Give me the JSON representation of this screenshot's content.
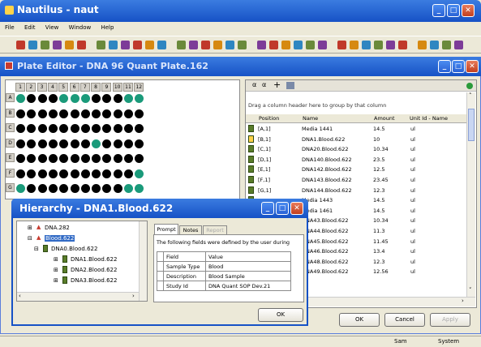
{
  "app": {
    "title": "Nautilus - naut"
  },
  "menu": [
    "File",
    "Edit",
    "View",
    "Window",
    "Help"
  ],
  "plate_editor": {
    "title": "Plate Editor - DNA 96 Quant Plate.162",
    "col_headers": [
      "1",
      "2",
      "3",
      "4",
      "5",
      "6",
      "7",
      "8",
      "9",
      "10",
      "11",
      "12"
    ],
    "row_headers": [
      "A",
      "B",
      "C",
      "D",
      "E",
      "F",
      "G"
    ],
    "well_colors": {
      "filled": "#000000",
      "empty": "#1a9a7a"
    }
  },
  "grid": {
    "group_hint": "Drag a column header here to group by that column",
    "headers": [
      "Position",
      "Name",
      "Amount",
      "Unit Id - Name"
    ],
    "rows": [
      {
        "pos": "[A,1]",
        "name": "Media 1441",
        "amount": "14.5",
        "unit": "ul"
      },
      {
        "pos": "[B,1]",
        "name": "DNA1.Blood.622",
        "amount": "10",
        "unit": "ul"
      },
      {
        "pos": "[C,1]",
        "name": "DNA20.Blood.622",
        "amount": "10.34",
        "unit": "ul"
      },
      {
        "pos": "[D,1]",
        "name": "DNA140.Blood.622",
        "amount": "23.5",
        "unit": "ul"
      },
      {
        "pos": "[E,1]",
        "name": "DNA142.Blood.622",
        "amount": "12.5",
        "unit": "ul"
      },
      {
        "pos": "[F,1]",
        "name": "DNA143.Blood.622",
        "amount": "23.45",
        "unit": "ul"
      },
      {
        "pos": "[G,1]",
        "name": "DNA144.Blood.622",
        "amount": "12.3",
        "unit": "ul"
      },
      {
        "pos": "",
        "name": "Media 1443",
        "amount": "14.5",
        "unit": "ul"
      },
      {
        "pos": "",
        "name": "Media 1461",
        "amount": "14.5",
        "unit": "ul"
      },
      {
        "pos": "",
        "name": "DNA43.Blood.622",
        "amount": "10.34",
        "unit": "ul"
      },
      {
        "pos": "",
        "name": "DNA44.Blood.622",
        "amount": "11.3",
        "unit": "ul"
      },
      {
        "pos": "",
        "name": "DNA45.Blood.622",
        "amount": "11.45",
        "unit": "ul"
      },
      {
        "pos": "",
        "name": "DNA46.Blood.622",
        "amount": "13.4",
        "unit": "ul"
      },
      {
        "pos": "",
        "name": "DNA48.Blood.622",
        "amount": "12.3",
        "unit": "ul"
      },
      {
        "pos": "",
        "name": "DNA49.Blood.622",
        "amount": "12.56",
        "unit": "ul"
      }
    ],
    "ok": "OK",
    "cancel": "Cancel",
    "apply": "Apply"
  },
  "hierarchy": {
    "title": "Hierarchy - DNA1.Blood.622",
    "tree": [
      "DNA.282",
      "Blood.622",
      "DNA0.Blood.622",
      "DNA1.Blood.622",
      "DNA2.Blood.622",
      "DNA3.Blood.622"
    ],
    "tabs": [
      "Prompt",
      "Notes",
      "Report"
    ],
    "info": "The following fields were defined by the user during",
    "field_header": "Field",
    "value_header": "Value",
    "fields": [
      {
        "field": "Sample Type",
        "value": "Blood"
      },
      {
        "field": "Description",
        "value": "Blood Sample"
      },
      {
        "field": "Study Id",
        "value": "DNA Quant SOP Dev.21"
      }
    ],
    "ok": "OK"
  },
  "status": {
    "user": "Sam",
    "role": "System"
  }
}
